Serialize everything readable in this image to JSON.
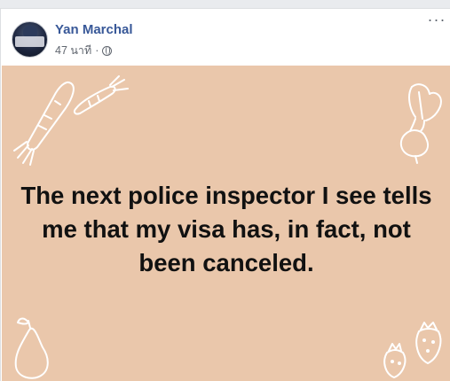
{
  "post": {
    "author": "Yan Marchal",
    "time": "47 นาที",
    "separator": "·",
    "privacy_icon": "globe-icon",
    "more_icon": "ellipsis-icon",
    "more_label": "···"
  },
  "card": {
    "background": "#eac7ab",
    "text": "The next police inspector I see tells me that my visa has, in fact, not been canceled."
  }
}
